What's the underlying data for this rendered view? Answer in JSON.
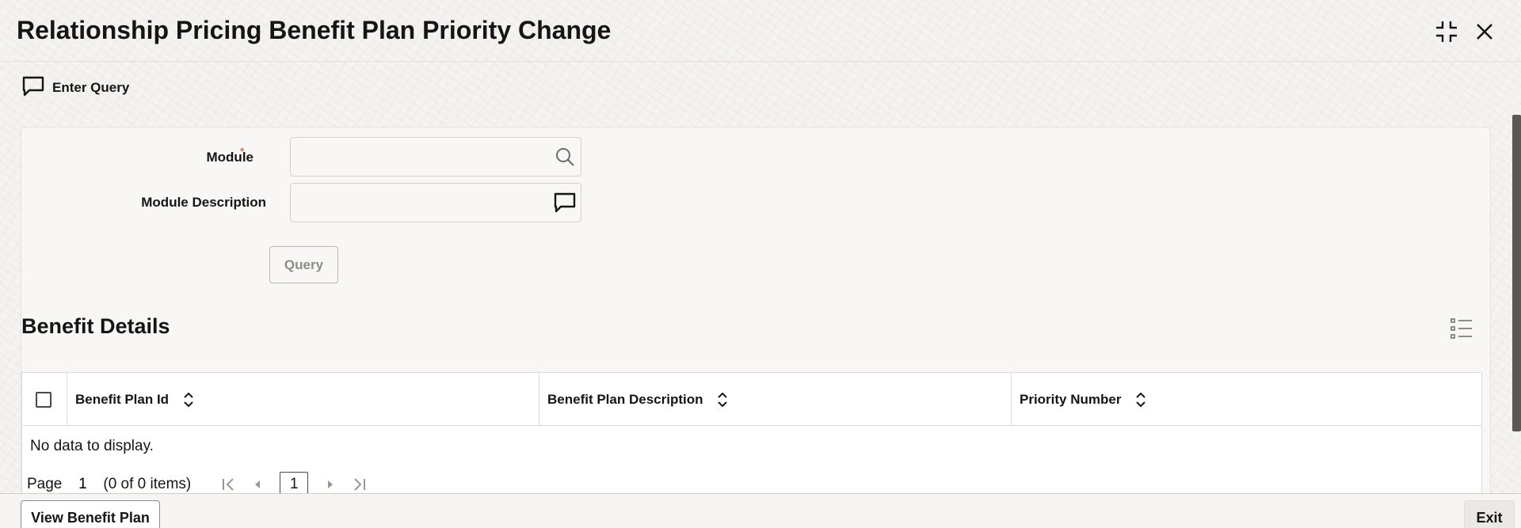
{
  "window": {
    "title": "Relationship Pricing Benefit Plan Priority Change",
    "compress_icon": "compress-icon",
    "close_icon": "close-icon"
  },
  "toolbar": {
    "enter_query_label": "Enter Query",
    "enter_query_icon": "chat-bubble-icon"
  },
  "form": {
    "module": {
      "label": "Module",
      "required_marker": "*",
      "value": "",
      "icon": "search-icon"
    },
    "module_description": {
      "label": "Module Description",
      "value": "",
      "icon": "chat-bubble-icon"
    },
    "query_button": "Query"
  },
  "benefit_details": {
    "title": "Benefit Details",
    "columns": [
      {
        "label": "Benefit Plan Id"
      },
      {
        "label": "Benefit Plan Description"
      },
      {
        "label": "Priority Number"
      }
    ],
    "empty_message": "No data to display.",
    "pagination": {
      "page_label": "Page",
      "page_value": "1",
      "items_summary": "(0 of 0 items)",
      "current_page": "1"
    }
  },
  "footer": {
    "view_benefit_plan": "View Benefit Plan",
    "exit": "Exit"
  },
  "colors": {
    "required": "#c74634",
    "text": "#161513",
    "disabled_text": "#8f8c87"
  }
}
